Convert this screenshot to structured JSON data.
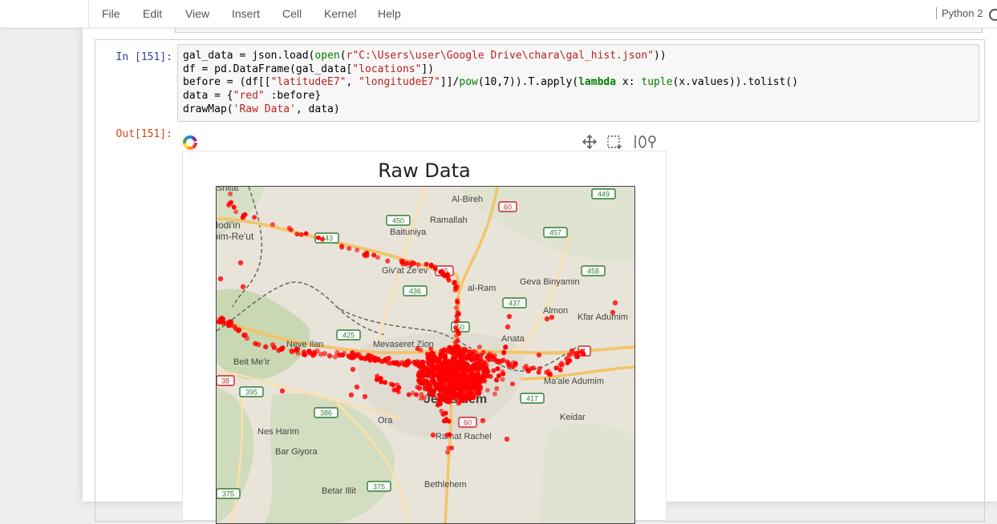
{
  "menubar": {
    "items": [
      "File",
      "Edit",
      "View",
      "Insert",
      "Cell",
      "Kernel",
      "Help"
    ],
    "kernel": "Python 2"
  },
  "cell": {
    "in_prompt": "In [151]:",
    "out_prompt": "Out[151]:",
    "code_lines": [
      "gal_data = json.load(open(r\"C:\\Users\\user\\Google Drive\\chara\\gal_hist.json\"))",
      "df = pd.DataFrame(gal_data[\"locations\"])",
      "before = (df[[\"latitudeE7\", \"longitudeE7\"]]/pow(10,7)).T.apply(lambda x: tuple(x.values)).tolist()",
      "data = {\"red\" :before}",
      "drawMap('Raw Data', data)"
    ]
  },
  "plot": {
    "title": "Raw Data",
    "point_color": "#ff0000",
    "place_labels": [
      "Shilat",
      "Al-Bireh",
      "Ramallah",
      "Baituniya",
      "Modi'in",
      "Maccabim-Re'ut",
      "Giv'at Ze'ev",
      "al-Ram",
      "Geva Binyamin",
      "Almon",
      "Kfar Adumim",
      "Neve Ilan",
      "Mevaseret Zion",
      "Anata",
      "Beit Me'ir",
      "Jerusalem",
      "Ma'ale Adumim",
      "Ora",
      "Keidar",
      "Nes Harim",
      "Ramat Rachel",
      "Bar Giyora",
      "Betar Illit",
      "Bethlehem"
    ],
    "road_shields": [
      "449",
      "60",
      "450",
      "443",
      "457",
      "45",
      "458",
      "436",
      "437",
      "50",
      "425",
      "1",
      "38",
      "395",
      "417",
      "386",
      "60",
      "375",
      "375"
    ]
  }
}
